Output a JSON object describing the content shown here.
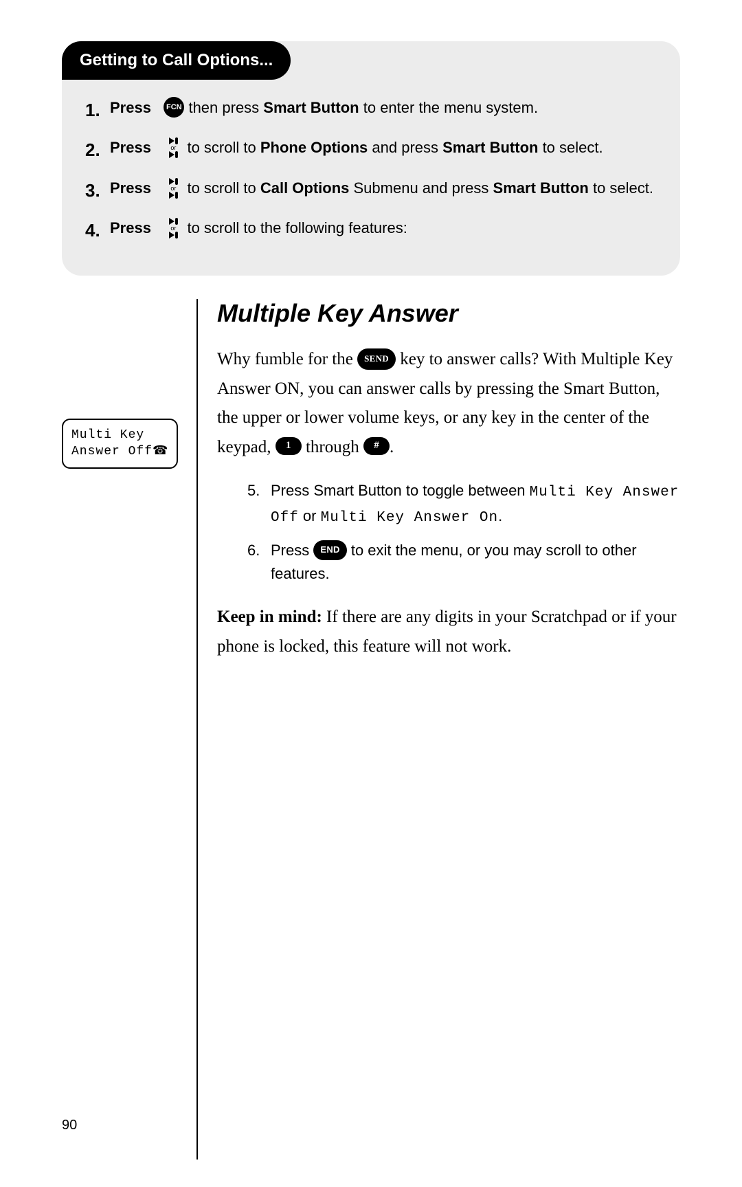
{
  "box": {
    "title": "Getting to Call Options...",
    "steps": [
      {
        "num": "1.",
        "press": "Press",
        "icon_type": "fcn",
        "icon_label": "FCN",
        "text_before": "",
        "text_after_prefix": " then press ",
        "bold1": "Smart Button",
        "tail": " to enter the menu system."
      },
      {
        "num": "2.",
        "press": "Press",
        "icon_type": "scroll",
        "text_after_prefix": " to scroll to ",
        "bold1": "Phone Options",
        "mid": " and press ",
        "bold2": "Smart Button",
        "tail": " to select."
      },
      {
        "num": "3.",
        "press": "Press",
        "icon_type": "scroll",
        "text_after_prefix": " to scroll to ",
        "bold1": "Call Options",
        "mid": " Submenu and press ",
        "bold2": "Smart Button",
        "tail": " to select."
      },
      {
        "num": "4.",
        "press": "Press",
        "icon_type": "scroll",
        "text_after_prefix": " to scroll to the following features:"
      }
    ]
  },
  "screen": {
    "line1": "Multi Key",
    "line2": "Answer Off",
    "phone_glyph": "☎"
  },
  "section": {
    "title": "Multiple Key Answer",
    "p1_a": "Why fumble for the ",
    "p1_icon_send": "SEND",
    "p1_b": " key to answer calls? With Multiple Key Answer ON, you can answer calls by pressing the Smart Button, the upper or lower volume keys, or any key in the center of the keypad, ",
    "key1": "1",
    "p1_c": " through ",
    "key_hash": "#",
    "p1_d": ".",
    "sub5_n": "5.",
    "sub5_a": "Press Smart Button to toggle between ",
    "sub5_lcd1": "Multi Key Answer Off",
    "sub5_or": " or ",
    "sub5_lcd2": "Multi Key Answer On",
    "sub5_end": ".",
    "sub6_n": "6.",
    "sub6_a": "Press ",
    "sub6_icon_end": "END",
    "sub6_b": " to exit the menu, or you may scroll to other features.",
    "note_label": "Keep in mind:",
    "note_text": " If there are any digits in your Scratchpad or if your phone is locked, this feature will not work."
  },
  "page_number": "90"
}
